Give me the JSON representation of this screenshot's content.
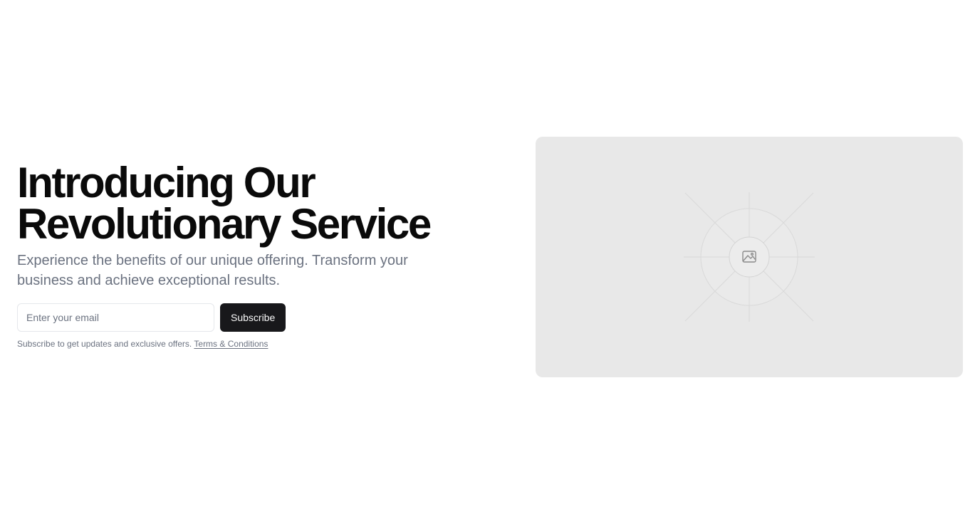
{
  "hero": {
    "title_line1": "Introducing Our",
    "title_line2": "Revolutionary Service",
    "subtitle": "Experience the benefits of our unique offering. Transform your business and achieve exceptional results."
  },
  "signup": {
    "email_placeholder": "Enter your email",
    "email_value": "",
    "subscribe_label": "Subscribe",
    "fine_print": "Subscribe to get updates and exclusive offers.",
    "terms_label": "Terms & Conditions"
  },
  "placeholder_image": {
    "icon": "image-icon",
    "background_color": "#e8e8e8"
  },
  "colors": {
    "button_bg": "#18181b",
    "button_text": "#fafafa",
    "muted_text": "#6b7280",
    "heading_text": "#0a0a0a"
  }
}
